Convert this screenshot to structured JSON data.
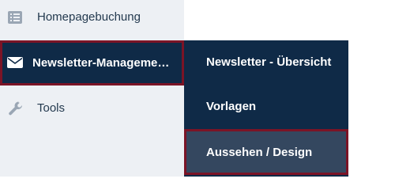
{
  "sidebar": {
    "items": [
      {
        "label": "Homepagebuchung",
        "icon": "list-icon"
      },
      {
        "label": "Newsletter-Managemen...",
        "icon": "envelope-icon",
        "active": true
      },
      {
        "label": "Tools",
        "icon": "wrench-icon"
      }
    ]
  },
  "submenu": {
    "items": [
      {
        "label": "Newsletter - Übersicht"
      },
      {
        "label": "Vorlagen"
      },
      {
        "label": "Aussehen / Design",
        "highlighted": true
      }
    ]
  },
  "colors": {
    "sidebar_bg": "#edf0f4",
    "nav_dark": "#0f2a47",
    "highlight_bg": "#34475f",
    "focus_border": "#7b1426",
    "text_dark": "#243a4f",
    "icon_muted": "#9aa6b4"
  }
}
